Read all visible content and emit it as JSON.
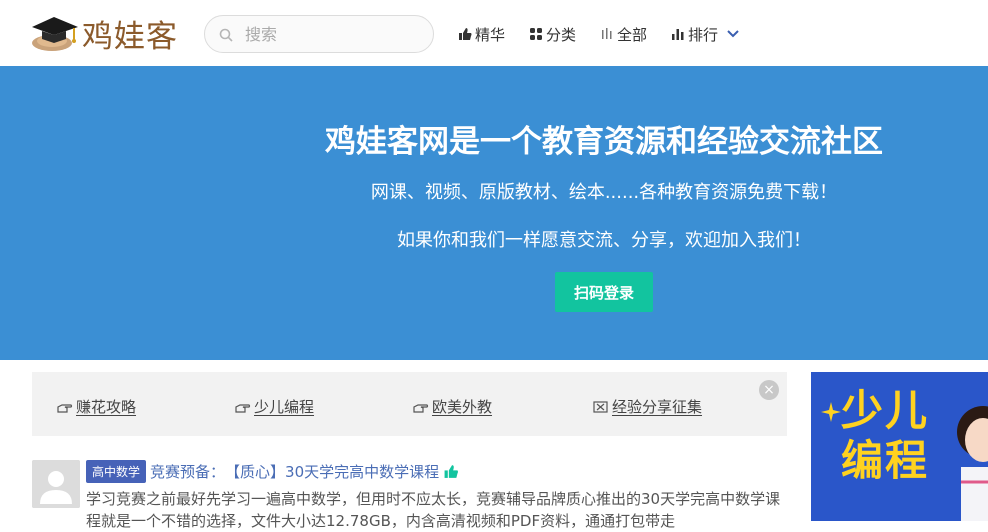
{
  "header": {
    "logo_text": "鸡娃客",
    "search": {
      "placeholder": "搜索"
    },
    "nav": [
      {
        "label": "精华",
        "icon": "thumbs-up-icon"
      },
      {
        "label": "分类",
        "icon": "grid-icon"
      },
      {
        "label": "全部",
        "icon": "bars-icon"
      },
      {
        "label": "排行",
        "icon": "bar-chart-icon"
      }
    ]
  },
  "banner": {
    "title": "鸡娃客网是一个教育资源和经验交流社区",
    "subtitle1": "网课、视频、原版教材、绘本......各种教育资源免费下载！",
    "subtitle2": "如果你和我们一样愿意交流、分享，欢迎加入我们！",
    "login_label": "扫码登录"
  },
  "tags": [
    {
      "label": "赚花攻略"
    },
    {
      "label": "少儿编程"
    },
    {
      "label": "欧美外教"
    },
    {
      "label": "经验分享征集"
    }
  ],
  "close_label": "×",
  "post": {
    "category": "高中数学",
    "prefix": "竞赛预备：",
    "title": "【质心】30天学完高中数学课程",
    "body": "学习竞赛之前最好先学习一遍高中数学，但用时不应太长，竞赛辅导品牌质心推出的30天学完高中数学课程就是一个不错的选择，文件大小达12.78GB，内含高清视频和PDF资料，通通打包带走"
  },
  "ad": {
    "line1": "少儿",
    "line2": "编程"
  },
  "colors": {
    "banner": "#3b8fd4",
    "login_button": "#12c49f",
    "badge": "#4662b8",
    "link": "#4a6db5",
    "ad_bg": "#2a56c9",
    "ad_text": "#ffd21f"
  }
}
